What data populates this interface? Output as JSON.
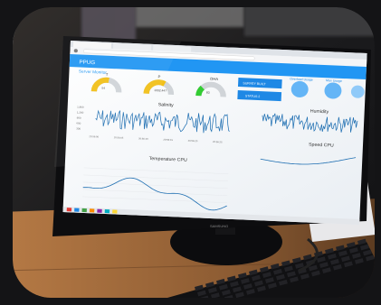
{
  "dashboard": {
    "app_title": "PPUG",
    "subtitle": "Server Monitor",
    "gauges": [
      {
        "label": "T",
        "value": "54",
        "fill": 0.55,
        "color": "#f2c018"
      },
      {
        "label": "P",
        "value": "1002.447",
        "fill": 0.65,
        "color": "#f2c018"
      },
      {
        "label": "DHA",
        "value": "83",
        "fill": 0.25,
        "color": "#33cc33"
      }
    ],
    "buttons": [
      "SURVEY BUILT",
      "STATUS 2"
    ],
    "status_labels": [
      "Overload Usage",
      "Max Usage"
    ],
    "chart_titles": {
      "salinity": "Salinity",
      "humidity": "Humidity",
      "temperature": "Temperature CPU",
      "speed": "Speed CPU"
    },
    "salinity_yticks": [
      "1,800",
      "1,200",
      "900",
      "600",
      "300"
    ],
    "salinity_xticks": [
      "20:56:00",
      "20:56:05",
      "20:56:10",
      "20:56:15",
      "20:56:20",
      "20:56:25"
    ],
    "monitor_brand": "SAMSUNG"
  },
  "colors": {
    "header_bar": "#2196f3",
    "series_line": "#1f6fb2",
    "screen_bg": "#f7f9fb",
    "desk_wood": "#8a5a32",
    "bezel": "#0d0d0f"
  },
  "icons": [
    "browser-tab-icon",
    "refresh-icon",
    "menu-icon",
    "monitor-logo"
  ]
}
